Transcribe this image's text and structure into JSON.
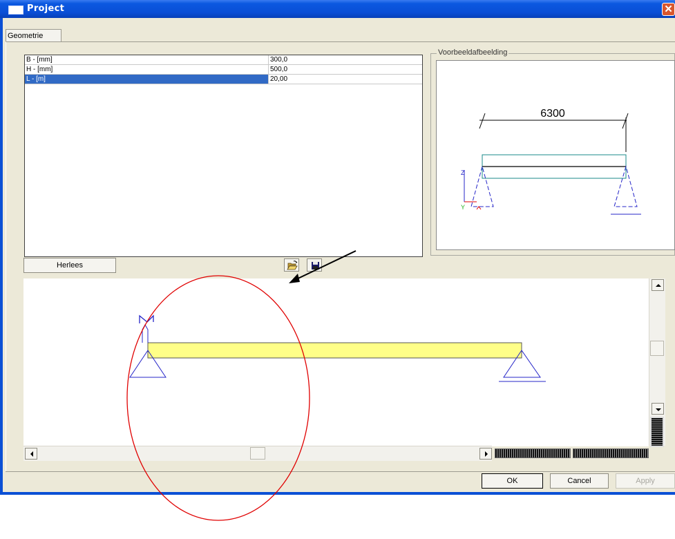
{
  "window": {
    "title": "Project",
    "colors": {
      "titlebar": "#0b58e0",
      "close": "#d9562e",
      "selection": "#316ac5",
      "beam_fill": "#ffff88",
      "support": "#2424c8",
      "annotation": "#e00000"
    }
  },
  "tabs": [
    {
      "label": "Geometrie"
    }
  ],
  "properties": {
    "rows": [
      {
        "label": "B - [mm]",
        "value": "300,0"
      },
      {
        "label": "H - [mm]",
        "value": "500,0"
      },
      {
        "label": "L - [m]",
        "value": "20,00",
        "selected": true
      }
    ]
  },
  "preview": {
    "title": "Voorbeeldafbeelding",
    "dimension": "6300",
    "axis_z": "Z",
    "axis_y": "Y"
  },
  "toolbar": {
    "reload_label": "Herlees",
    "open_icon": "folder-open-icon",
    "save_icon": "floppy-disk-icon"
  },
  "footer": {
    "ok_label": "OK",
    "cancel_label": "Cancel",
    "apply_label": "Apply"
  }
}
